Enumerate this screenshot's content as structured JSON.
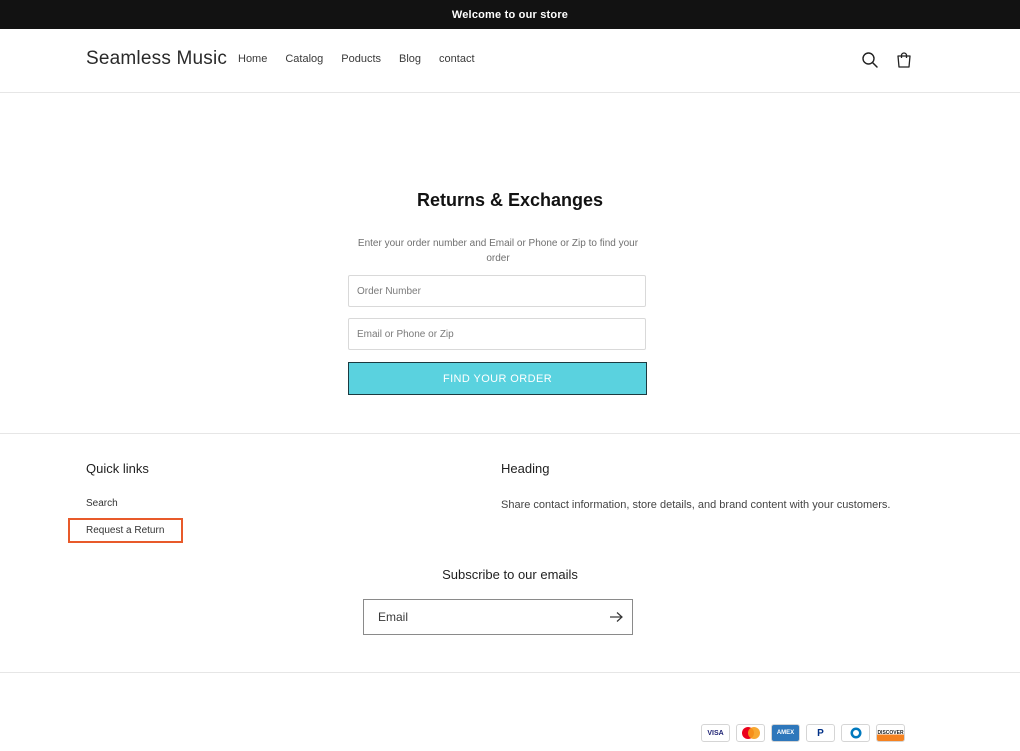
{
  "announcement": "Welcome to our store",
  "header": {
    "logo": "Seamless Music",
    "nav": [
      "Home",
      "Catalog",
      "Poducts",
      "Blog",
      "contact"
    ],
    "icons": [
      "search-icon",
      "cart-icon"
    ]
  },
  "main": {
    "title": "Returns & Exchanges",
    "instructions": "Enter your order number and Email or Phone or Zip to find your order",
    "order_placeholder": "Order Number",
    "contact_placeholder": "Email or Phone or Zip",
    "button": "FIND YOUR ORDER"
  },
  "footer": {
    "quick_links_heading": "Quick links",
    "links": [
      "Search",
      "Request a Return"
    ],
    "heading": "Heading",
    "text": "Share contact information, store details, and brand content with your customers.",
    "subscribe_title": "Subscribe to our emails",
    "email_placeholder": "Email",
    "payments": [
      {
        "name": "visa",
        "label": "VISA"
      },
      {
        "name": "mastercard",
        "label": ""
      },
      {
        "name": "amex",
        "label": "AMEX"
      },
      {
        "name": "paypal",
        "label": "P"
      },
      {
        "name": "diners",
        "label": ""
      },
      {
        "name": "discover",
        "label": "DISCOVER"
      }
    ]
  },
  "colors": {
    "announcement_bg": "#121212",
    "button_bg": "#5ad2df",
    "highlight": "#e85a2a"
  }
}
